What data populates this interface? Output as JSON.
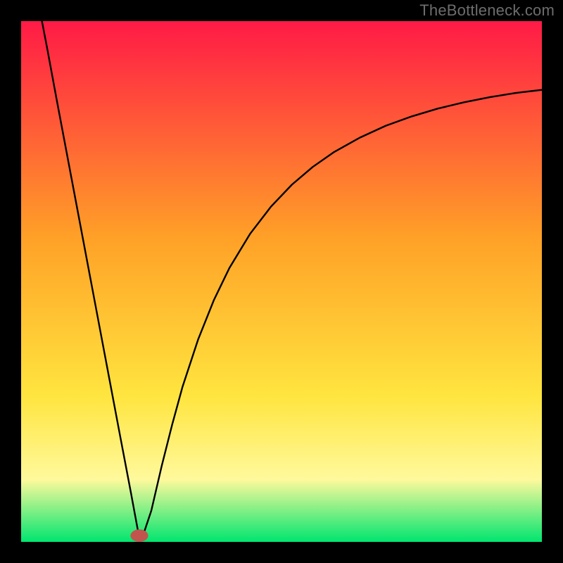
{
  "watermark": "TheBottleneck.com",
  "chart_data": {
    "type": "line",
    "title": "",
    "xlabel": "",
    "ylabel": "",
    "xlim": [
      0,
      100
    ],
    "ylim": [
      0,
      100
    ],
    "gradient": {
      "top": "#ff1a46",
      "mid1": "#ffa227",
      "mid2": "#ffe53f",
      "mid3": "#fff99c",
      "bottom": "#00e56f"
    },
    "frame_border_px": 30,
    "marker": {
      "x": 22.7,
      "y": 1.2,
      "rx": 1.7,
      "ry": 1.2,
      "color": "#c1554e"
    },
    "series": [
      {
        "name": "curve",
        "points": [
          {
            "x": 4.0,
            "y": 100.0
          },
          {
            "x": 5.0,
            "y": 94.8
          },
          {
            "x": 7.0,
            "y": 84.0
          },
          {
            "x": 9.0,
            "y": 73.4
          },
          {
            "x": 11.0,
            "y": 62.8
          },
          {
            "x": 13.0,
            "y": 52.2
          },
          {
            "x": 15.0,
            "y": 41.6
          },
          {
            "x": 17.0,
            "y": 31.0
          },
          {
            "x": 19.0,
            "y": 20.4
          },
          {
            "x": 21.0,
            "y": 9.9
          },
          {
            "x": 22.5,
            "y": 1.8
          },
          {
            "x": 23.0,
            "y": 1.4
          },
          {
            "x": 23.6,
            "y": 1.8
          },
          {
            "x": 25.0,
            "y": 6.0
          },
          {
            "x": 27.0,
            "y": 14.6
          },
          {
            "x": 29.0,
            "y": 22.5
          },
          {
            "x": 31.0,
            "y": 29.8
          },
          {
            "x": 34.0,
            "y": 38.9
          },
          {
            "x": 37.0,
            "y": 46.4
          },
          {
            "x": 40.0,
            "y": 52.6
          },
          {
            "x": 44.0,
            "y": 59.2
          },
          {
            "x": 48.0,
            "y": 64.4
          },
          {
            "x": 52.0,
            "y": 68.6
          },
          {
            "x": 56.0,
            "y": 72.0
          },
          {
            "x": 60.0,
            "y": 74.8
          },
          {
            "x": 65.0,
            "y": 77.6
          },
          {
            "x": 70.0,
            "y": 79.9
          },
          {
            "x": 75.0,
            "y": 81.7
          },
          {
            "x": 80.0,
            "y": 83.2
          },
          {
            "x": 85.0,
            "y": 84.4
          },
          {
            "x": 90.0,
            "y": 85.4
          },
          {
            "x": 95.0,
            "y": 86.2
          },
          {
            "x": 100.0,
            "y": 86.8
          }
        ]
      }
    ]
  }
}
